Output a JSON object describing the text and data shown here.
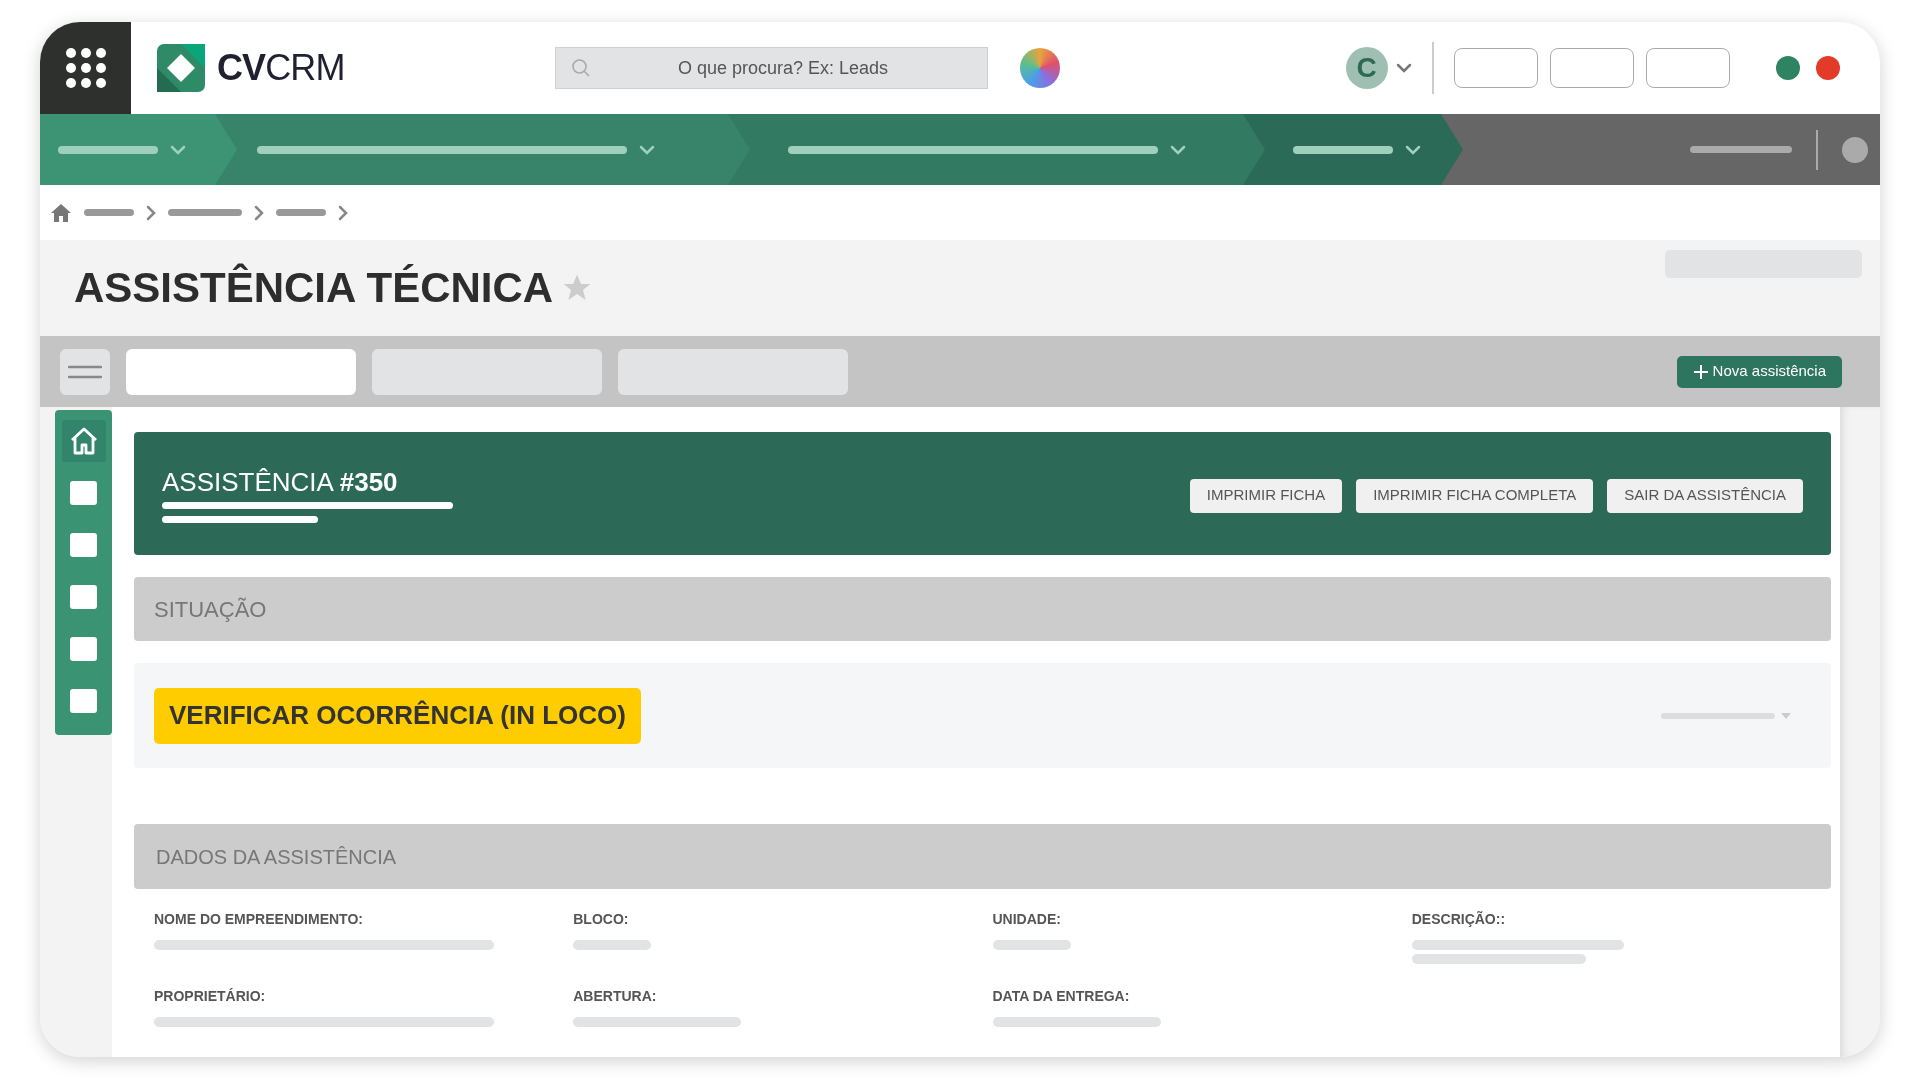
{
  "header": {
    "logo_text": "CV",
    "logo_text_light": "CRM",
    "search": {
      "placeholder": "O que procura? Ex: Leads"
    },
    "user": {
      "initial": "C"
    },
    "status_dots": [
      {
        "color": "#2e8462"
      },
      {
        "color": "#e23b2a"
      }
    ]
  },
  "page": {
    "title": "ASSISTÊNCIA TÉCNICA",
    "favorite": false
  },
  "toolbar": {
    "tabs": [
      {
        "selected": true
      },
      {
        "selected": false
      },
      {
        "selected": false
      }
    ],
    "new_button": "Nova assistência"
  },
  "side_nav": [
    {
      "kind": "home",
      "selected": true
    },
    {
      "kind": "page",
      "selected": false
    },
    {
      "kind": "page",
      "selected": false
    },
    {
      "kind": "page",
      "selected": false
    },
    {
      "kind": "page",
      "selected": false
    },
    {
      "kind": "page",
      "selected": false
    }
  ],
  "record": {
    "title": "ASSISTÊNCIA **#350**",
    "buttons": [
      "IMPRIMIR FICHA",
      "IMPRIMIR FICHA COMPLETA",
      "SAIR DA ASSISTÊNCIA"
    ]
  },
  "situation": {
    "heading": "SITUAÇÃO",
    "status": "VERIFICAR OCORRÊNCIA (IN LOCO)"
  },
  "details": {
    "heading": "DADOS DA ASSISTÊNCIA",
    "fields": [
      {
        "label": "NOME DO EMPREENDIMENTO:"
      },
      {
        "label": "BLOCO:"
      },
      {
        "label": "UNIDADE:"
      },
      {
        "label": "DESCRIÇÃO::"
      },
      {
        "label": "PROPRIETÁRIO:"
      },
      {
        "label": "ABERTURA:"
      },
      {
        "label": "DATA DA ENTREGA:"
      }
    ]
  }
}
